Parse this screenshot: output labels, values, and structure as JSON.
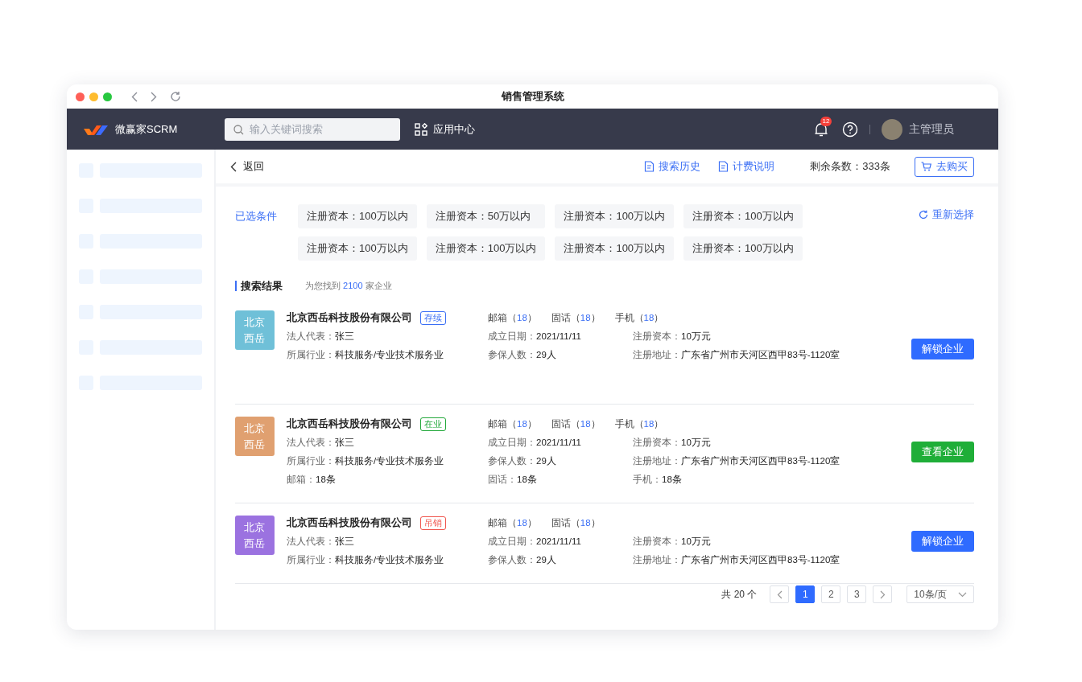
{
  "window": {
    "title": "销售管理系统"
  },
  "header": {
    "brand": "微赢家SCRM",
    "search": {
      "placeholder": "输入关键词搜索"
    },
    "app_center": "应用中心",
    "notification_count": "12",
    "user_name": "主管理员"
  },
  "toolbar": {
    "back": "返回",
    "links": [
      "搜索历史",
      "计费说明"
    ],
    "remaining": "剩余条数：333条",
    "buy": "去购买"
  },
  "filters": {
    "label": "已选条件",
    "tags": [
      "注册资本：100万以内",
      "注册资本：50万以内",
      "注册资本：100万以内",
      "注册资本：100万以内",
      "注册资本：100万以内",
      "注册资本：100万以内",
      "注册资本：100万以内",
      "注册资本：100万以内"
    ],
    "reset": "重新选择"
  },
  "results": {
    "title": "搜索结果",
    "summary_prefix": "为您找到",
    "count": "2100",
    "summary_suffix": "家企业"
  },
  "companies": [
    {
      "avatar_text": "北京西岳",
      "color": "#6fc0d8",
      "name": "北京西岳科技股份有限公司",
      "status": {
        "label": "存续",
        "kind": "active"
      },
      "contacts": [
        {
          "prefix": "邮箱（",
          "count": "18",
          "suffix": "）"
        },
        {
          "prefix": "固话（",
          "count": "18",
          "suffix": "）"
        },
        {
          "prefix": "手机（",
          "count": "18",
          "suffix": "）"
        }
      ],
      "rows": [
        [
          {
            "label": "法人代表：",
            "value": "张三"
          },
          {
            "label": "成立日期：",
            "value": "2021/11/11"
          },
          {
            "label": "注册资本：",
            "value": "10万元"
          }
        ],
        [
          {
            "label": "所属行业：",
            "value": "科技服务/专业技术服务业"
          },
          {
            "label": "参保人数：",
            "value": "29人"
          },
          {
            "label": "注册地址：",
            "value": "广东省广州市天河区西甲83号-1120室"
          }
        ]
      ],
      "action": {
        "label": "解锁企业",
        "kind": "primary"
      }
    },
    {
      "avatar_text": "北京西岳",
      "color": "#e0a070",
      "name": "北京西岳科技股份有限公司",
      "status": {
        "label": "在业",
        "kind": "operating"
      },
      "contacts": [
        {
          "prefix": "邮箱（",
          "count": "18",
          "suffix": "）"
        },
        {
          "prefix": "固话（",
          "count": "18",
          "suffix": "）"
        },
        {
          "prefix": "手机（",
          "count": "18",
          "suffix": "）"
        }
      ],
      "rows": [
        [
          {
            "label": "法人代表：",
            "value": "张三"
          },
          {
            "label": "成立日期：",
            "value": "2021/11/11"
          },
          {
            "label": "注册资本：",
            "value": "10万元"
          }
        ],
        [
          {
            "label": "所属行业：",
            "value": "科技服务/专业技术服务业"
          },
          {
            "label": "参保人数：",
            "value": "29人"
          },
          {
            "label": "注册地址：",
            "value": "广东省广州市天河区西甲83号-1120室"
          }
        ],
        [
          {
            "label": "邮箱：",
            "value": "18条"
          },
          {
            "label": "固话：",
            "value": "18条"
          },
          {
            "label": "手机：",
            "value": "18条"
          }
        ]
      ],
      "action": {
        "label": "查看企业",
        "kind": "success"
      }
    },
    {
      "avatar_text": "北京西岳",
      "color": "#9b72e0",
      "name": "北京西岳科技股份有限公司",
      "status": {
        "label": "吊销",
        "kind": "revoked"
      },
      "contacts": [
        {
          "prefix": "邮箱（",
          "count": "18",
          "suffix": "）"
        },
        {
          "prefix": "固话（",
          "count": "18",
          "suffix": "）"
        }
      ],
      "rows": [
        [
          {
            "label": "法人代表：",
            "value": "张三"
          },
          {
            "label": "成立日期：",
            "value": "2021/11/11"
          },
          {
            "label": "注册资本：",
            "value": "10万元"
          }
        ],
        [
          {
            "label": "所属行业：",
            "value": "科技服务/专业技术服务业"
          },
          {
            "label": "参保人数：",
            "value": "29人"
          },
          {
            "label": "注册地址：",
            "value": "广东省广州市天河区西甲83号-1120室"
          }
        ]
      ],
      "action": {
        "label": "解锁企业",
        "kind": "primary"
      }
    }
  ],
  "pagination": {
    "total": "共 20 个",
    "pages": [
      {
        "label": "1",
        "selected": true
      },
      {
        "label": "2",
        "selected": false
      },
      {
        "label": "3",
        "selected": false
      }
    ],
    "page_size": "10条/页"
  }
}
